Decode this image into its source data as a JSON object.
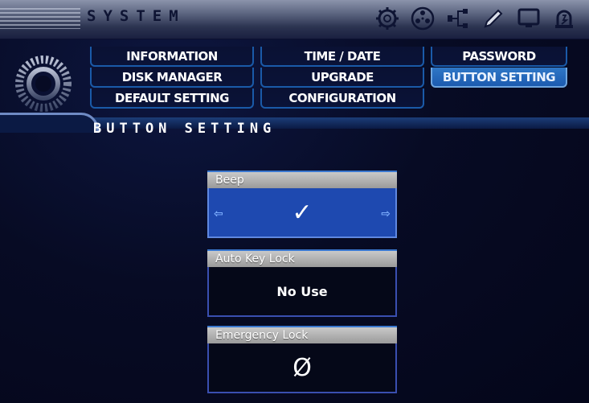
{
  "header": {
    "title": "SYSTEM",
    "icons": [
      "gear-icon",
      "reel-icon",
      "network-icon",
      "pen-icon",
      "monitor-icon",
      "alarm-icon"
    ]
  },
  "menu": {
    "items": [
      {
        "label": "INFORMATION",
        "active": false
      },
      {
        "label": "TIME / DATE",
        "active": false
      },
      {
        "label": "PASSWORD",
        "active": false
      },
      {
        "label": "DISK MANAGER",
        "active": false
      },
      {
        "label": "UPGRADE",
        "active": false
      },
      {
        "label": "BUTTON SETTING",
        "active": true
      },
      {
        "label": "DEFAULT SETTING",
        "active": false
      },
      {
        "label": "CONFIGURATION",
        "active": false
      }
    ]
  },
  "section": {
    "title": "BUTTON SETTING"
  },
  "settings": [
    {
      "label": "Beep",
      "value": "✓",
      "selected": true
    },
    {
      "label": "Auto Key Lock",
      "value": "No Use",
      "selected": false
    },
    {
      "label": "Emergency Lock",
      "value": "Ø",
      "selected": false
    }
  ],
  "colors": {
    "accent": "#1e49b0",
    "active_menu": "#2f77c6",
    "panel_border": "#3a4fb0"
  }
}
